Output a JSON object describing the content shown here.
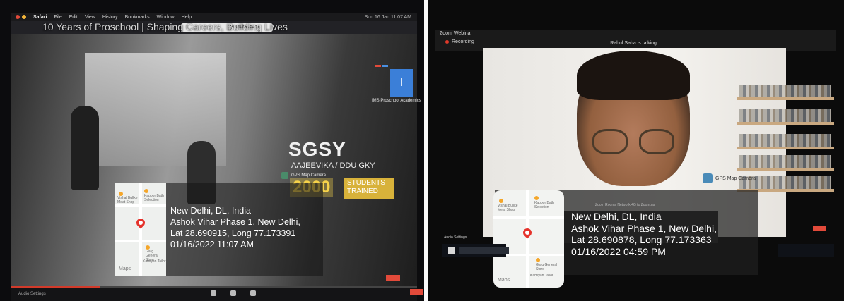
{
  "left_photo": {
    "browser_app": "Safari",
    "menu_items": [
      "File",
      "Edit",
      "View",
      "History",
      "Bookmarks",
      "Window",
      "Help"
    ],
    "clock": "Sun 16 Jan  11:07 AM",
    "url": "youtube.com",
    "video_title": "10 Years of Proschool | Shaping Careers, Building Lives",
    "channel_initial": "I",
    "channel_name": "IMS Proschool Academics",
    "headline": "SGSY",
    "subheadline": "AAJEEVIKA / DDU GKY",
    "stat_number": "2000",
    "stat_label": "STUDENTS TRAINED",
    "watermark": "GPS Map Camera",
    "geotag": {
      "line1": "New Delhi, DL, India",
      "line2": "Ashok Vihar Phase 1, New Delhi,",
      "line3": "Lat 28.690915, Long 77.173391",
      "line4": "01/16/2022 11:07 AM"
    },
    "map_labels": [
      "Vishal Bullke Meat Shop",
      "Kapoor Bath Selection",
      "Garg General Store",
      "Kamlyan Tailor"
    ],
    "map_logo": "Maps",
    "audio_settings": "Audio Settings"
  },
  "right_photo": {
    "app_title": "Zoom Webinar",
    "recording": "Recording",
    "talking": "Rahul Saha is talking...",
    "watermark": "GPS Map Camera",
    "notification": "Zoom Rooms Network 4G to Zoom.us",
    "geotag": {
      "line1": "New Delhi, DL, India",
      "line2": "Ashok Vihar Phase 1, New Delhi,",
      "line3": "Lat 28.690878, Long 77.173363",
      "line4": "01/16/2022 04:59 PM"
    },
    "map_labels": [
      "Vishal Bullke Meat Shop",
      "Kapoor Bath Selection",
      "Garg General Store",
      "Kamlyan Tailor"
    ],
    "map_logo": "Maps",
    "audio_settings": "Audio Settings"
  },
  "colors": {
    "accent_yellow": "#f7d34a",
    "end_button_red": "#e24a3a",
    "map_pin_red": "#e5322b"
  }
}
